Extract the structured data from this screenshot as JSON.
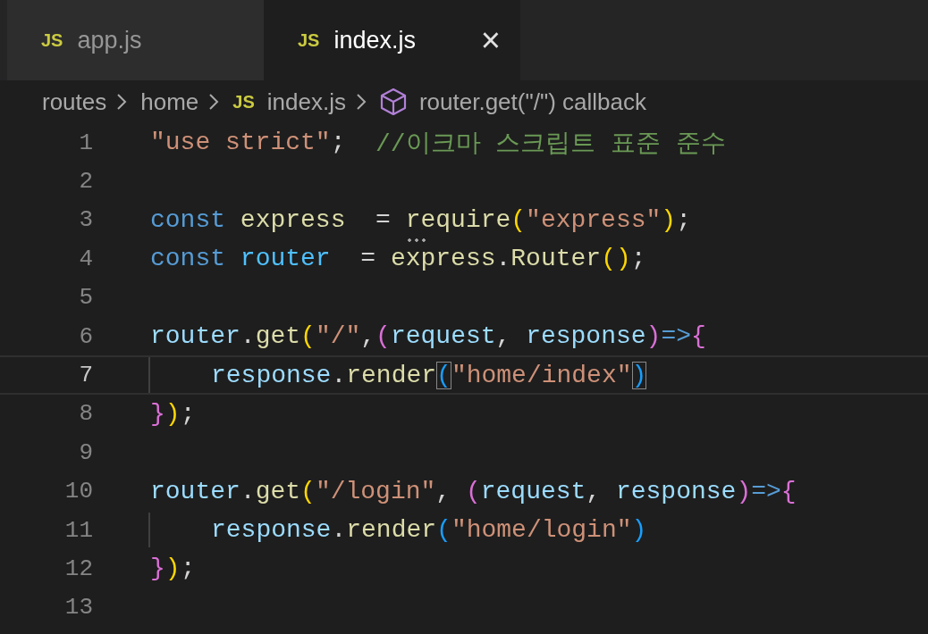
{
  "tabs": [
    {
      "icon": "JS",
      "label": "app.js",
      "selected": false
    },
    {
      "icon": "JS",
      "label": "index.js",
      "selected": true,
      "close": "×"
    }
  ],
  "breadcrumbs": [
    {
      "kind": "folder",
      "label": "routes"
    },
    {
      "kind": "folder",
      "label": "home"
    },
    {
      "kind": "file",
      "icon": "JS",
      "label": "index.js"
    },
    {
      "kind": "symbol",
      "label": "router.get(\"/\") callback"
    }
  ],
  "lines": [
    {
      "number": "1",
      "current": false,
      "indented": false,
      "tokens": [
        {
          "kind": "string",
          "text": "\"use strict\""
        },
        {
          "kind": "plain",
          "text": ";  "
        },
        {
          "kind": "comment",
          "text": "//이크마 스크립트 표준 준수"
        }
      ]
    },
    {
      "number": "2",
      "current": false
    },
    {
      "number": "3",
      "current": false,
      "indented": false,
      "tokens": [
        {
          "kind": "keyword",
          "text": "const "
        },
        {
          "kind": "func",
          "text": "express"
        },
        {
          "kind": "plain",
          "text": "  = "
        },
        {
          "kind": "hint-func",
          "text": "require"
        },
        {
          "kind": "b1",
          "text": "("
        },
        {
          "kind": "string",
          "text": "\"express\""
        },
        {
          "kind": "b1",
          "text": ")"
        },
        {
          "kind": "plain",
          "text": ";"
        }
      ]
    },
    {
      "number": "4",
      "current": false,
      "indented": false,
      "tokens": [
        {
          "kind": "keyword",
          "text": "const "
        },
        {
          "kind": "const",
          "text": "router"
        },
        {
          "kind": "plain",
          "text": "  = "
        },
        {
          "kind": "func",
          "text": "express"
        },
        {
          "kind": "plain",
          "text": "."
        },
        {
          "kind": "func",
          "text": "Router"
        },
        {
          "kind": "b1",
          "text": "()"
        },
        {
          "kind": "plain",
          "text": ";"
        }
      ]
    },
    {
      "number": "5",
      "current": false
    },
    {
      "number": "6",
      "current": false,
      "indented": false,
      "tokens": [
        {
          "kind": "var",
          "text": "router"
        },
        {
          "kind": "plain",
          "text": "."
        },
        {
          "kind": "func",
          "text": "get"
        },
        {
          "kind": "b1",
          "text": "("
        },
        {
          "kind": "string",
          "text": "\"/\""
        },
        {
          "kind": "plain",
          "text": ","
        },
        {
          "kind": "b2",
          "text": "("
        },
        {
          "kind": "var",
          "text": "request"
        },
        {
          "kind": "plain",
          "text": ", "
        },
        {
          "kind": "var",
          "text": "response"
        },
        {
          "kind": "b2",
          "text": ")"
        },
        {
          "kind": "keyword",
          "text": "=>"
        },
        {
          "kind": "b2",
          "text": "{"
        }
      ]
    },
    {
      "number": "7",
      "current": true,
      "indented": true,
      "tokens": [
        {
          "kind": "var",
          "text": "response"
        },
        {
          "kind": "plain",
          "text": "."
        },
        {
          "kind": "func",
          "text": "render"
        },
        {
          "kind": "match-b3",
          "text": "("
        },
        {
          "kind": "string",
          "text": "\"home/index\""
        },
        {
          "kind": "match-b3",
          "text": ")"
        }
      ]
    },
    {
      "number": "8",
      "current": false,
      "indented": false,
      "tokens": [
        {
          "kind": "b2",
          "text": "}"
        },
        {
          "kind": "b1",
          "text": ")"
        },
        {
          "kind": "plain",
          "text": ";"
        }
      ]
    },
    {
      "number": "9",
      "current": false
    },
    {
      "number": "10",
      "current": false,
      "indented": false,
      "tokens": [
        {
          "kind": "var",
          "text": "router"
        },
        {
          "kind": "plain",
          "text": "."
        },
        {
          "kind": "func",
          "text": "get"
        },
        {
          "kind": "b1",
          "text": "("
        },
        {
          "kind": "string",
          "text": "\"/login\""
        },
        {
          "kind": "plain",
          "text": ", "
        },
        {
          "kind": "b2",
          "text": "("
        },
        {
          "kind": "var",
          "text": "request"
        },
        {
          "kind": "plain",
          "text": ", "
        },
        {
          "kind": "var",
          "text": "response"
        },
        {
          "kind": "b2",
          "text": ")"
        },
        {
          "kind": "keyword",
          "text": "=>"
        },
        {
          "kind": "b2",
          "text": "{"
        }
      ]
    },
    {
      "number": "11",
      "current": false,
      "indented": true,
      "tokens": [
        {
          "kind": "var",
          "text": "response"
        },
        {
          "kind": "plain",
          "text": "."
        },
        {
          "kind": "func",
          "text": "render"
        },
        {
          "kind": "b3",
          "text": "("
        },
        {
          "kind": "string",
          "text": "\"home/login\""
        },
        {
          "kind": "b3",
          "text": ")"
        }
      ]
    },
    {
      "number": "12",
      "current": false,
      "indented": false,
      "tokens": [
        {
          "kind": "b2",
          "text": "}"
        },
        {
          "kind": "b1",
          "text": ")"
        },
        {
          "kind": "plain",
          "text": ";"
        }
      ]
    },
    {
      "number": "13",
      "current": false
    }
  ]
}
